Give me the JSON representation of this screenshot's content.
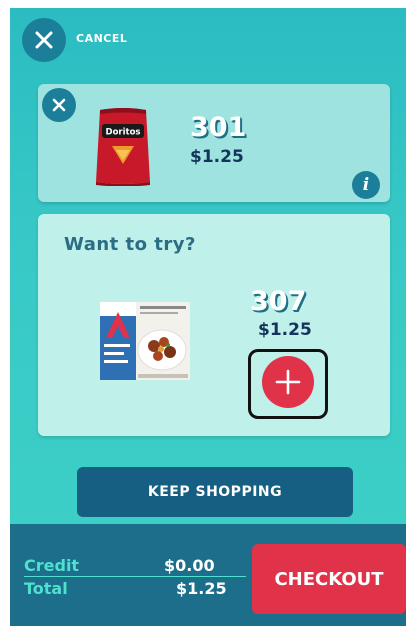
{
  "header": {
    "cancel_label": "CANCEL"
  },
  "cart_item": {
    "product": "Doritos",
    "number": "301",
    "price": "$1.25",
    "info_label": "i"
  },
  "suggestion": {
    "heading": "Want to try?",
    "number": "307",
    "price": "$1.25"
  },
  "actions": {
    "keep_shopping_label": "KEEP SHOPPING",
    "checkout_label": "CHECKOUT"
  },
  "totals": {
    "credit_label": "Credit",
    "credit_value": "$0.00",
    "total_label": "Total",
    "total_value": "$1.25"
  },
  "colors": {
    "background": "#38c9c6",
    "card": "#9fe3e0",
    "card_light": "#bff0ea",
    "dark_teal": "#1b7f9a",
    "navy": "#165f83",
    "accent_red": "#e0334a",
    "mint": "#4fe0cf"
  },
  "icons": [
    "close-icon",
    "info-icon",
    "plus-icon"
  ]
}
